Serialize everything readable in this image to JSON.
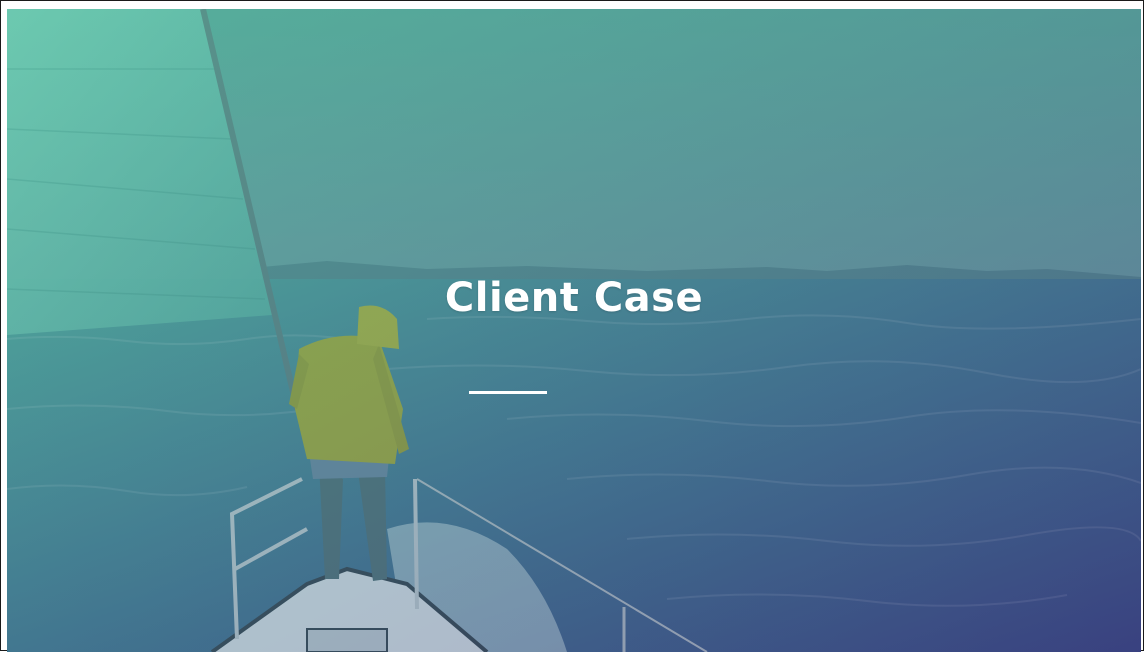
{
  "slide": {
    "title": "Client Case"
  },
  "colors": {
    "overlay_top_left": "#5fbfa5",
    "overlay_bottom_right": "#3e4f8a",
    "title_text": "#ffffff",
    "divider": "#ffffff",
    "jacket": "#b3b52a"
  },
  "background": {
    "subject": "sailor-on-sailboat-bow"
  }
}
